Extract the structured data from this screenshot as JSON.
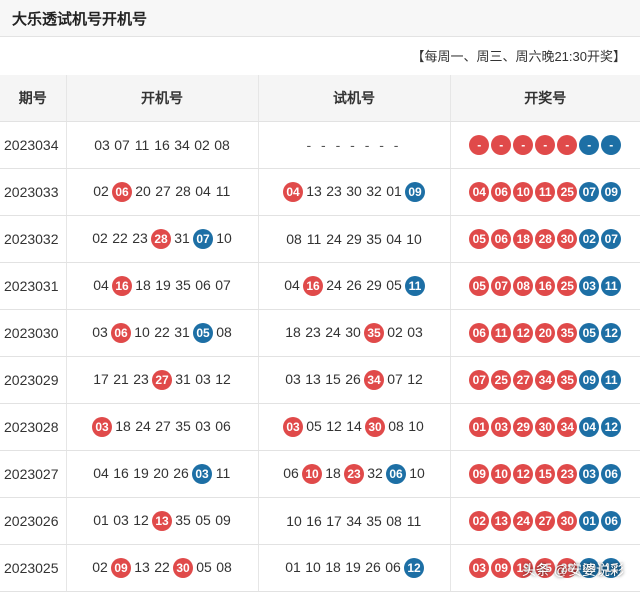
{
  "title": "大乐透试机号开机号",
  "schedule": "【每周一、周三、周六晚21:30开奖】",
  "headers": [
    "期号",
    "开机号",
    "试机号",
    "开奖号"
  ],
  "colors": {
    "red": "#e04a4a",
    "blue": "#1d6fa5"
  },
  "watermark": "头条 @安婆说彩",
  "rows": [
    {
      "period": "2023034",
      "open": [
        {
          "v": "03",
          "c": "p"
        },
        {
          "v": "07",
          "c": "p"
        },
        {
          "v": "11",
          "c": "p"
        },
        {
          "v": "16",
          "c": "p"
        },
        {
          "v": "34",
          "c": "p"
        },
        {
          "v": "02",
          "c": "p"
        },
        {
          "v": "08",
          "c": "p"
        }
      ],
      "test": [
        {
          "v": "- - - - - - -",
          "c": "d"
        }
      ],
      "draw": [
        {
          "v": "-",
          "c": "r"
        },
        {
          "v": "-",
          "c": "r"
        },
        {
          "v": "-",
          "c": "r"
        },
        {
          "v": "-",
          "c": "r"
        },
        {
          "v": "-",
          "c": "r"
        },
        {
          "v": "-",
          "c": "b"
        },
        {
          "v": "-",
          "c": "b"
        }
      ]
    },
    {
      "period": "2023033",
      "open": [
        {
          "v": "02",
          "c": "p"
        },
        {
          "v": "06",
          "c": "r"
        },
        {
          "v": "20",
          "c": "p"
        },
        {
          "v": "27",
          "c": "p"
        },
        {
          "v": "28",
          "c": "p"
        },
        {
          "v": "04",
          "c": "p"
        },
        {
          "v": "11",
          "c": "p"
        }
      ],
      "test": [
        {
          "v": "04",
          "c": "r"
        },
        {
          "v": "13",
          "c": "p"
        },
        {
          "v": "23",
          "c": "p"
        },
        {
          "v": "30",
          "c": "p"
        },
        {
          "v": "32",
          "c": "p"
        },
        {
          "v": "01",
          "c": "p"
        },
        {
          "v": "09",
          "c": "b"
        }
      ],
      "draw": [
        {
          "v": "04",
          "c": "r"
        },
        {
          "v": "06",
          "c": "r"
        },
        {
          "v": "10",
          "c": "r"
        },
        {
          "v": "11",
          "c": "r"
        },
        {
          "v": "25",
          "c": "r"
        },
        {
          "v": "07",
          "c": "b"
        },
        {
          "v": "09",
          "c": "b"
        }
      ]
    },
    {
      "period": "2023032",
      "open": [
        {
          "v": "02",
          "c": "p"
        },
        {
          "v": "22",
          "c": "p"
        },
        {
          "v": "23",
          "c": "p"
        },
        {
          "v": "28",
          "c": "r"
        },
        {
          "v": "31",
          "c": "p"
        },
        {
          "v": "07",
          "c": "b"
        },
        {
          "v": "10",
          "c": "p"
        }
      ],
      "test": [
        {
          "v": "08",
          "c": "p"
        },
        {
          "v": "11",
          "c": "p"
        },
        {
          "v": "24",
          "c": "p"
        },
        {
          "v": "29",
          "c": "p"
        },
        {
          "v": "35",
          "c": "p"
        },
        {
          "v": "04",
          "c": "p"
        },
        {
          "v": "10",
          "c": "p"
        }
      ],
      "draw": [
        {
          "v": "05",
          "c": "r"
        },
        {
          "v": "06",
          "c": "r"
        },
        {
          "v": "18",
          "c": "r"
        },
        {
          "v": "28",
          "c": "r"
        },
        {
          "v": "30",
          "c": "r"
        },
        {
          "v": "02",
          "c": "b"
        },
        {
          "v": "07",
          "c": "b"
        }
      ]
    },
    {
      "period": "2023031",
      "open": [
        {
          "v": "04",
          "c": "p"
        },
        {
          "v": "16",
          "c": "r"
        },
        {
          "v": "18",
          "c": "p"
        },
        {
          "v": "19",
          "c": "p"
        },
        {
          "v": "35",
          "c": "p"
        },
        {
          "v": "06",
          "c": "p"
        },
        {
          "v": "07",
          "c": "p"
        }
      ],
      "test": [
        {
          "v": "04",
          "c": "p"
        },
        {
          "v": "16",
          "c": "r"
        },
        {
          "v": "24",
          "c": "p"
        },
        {
          "v": "26",
          "c": "p"
        },
        {
          "v": "29",
          "c": "p"
        },
        {
          "v": "05",
          "c": "p"
        },
        {
          "v": "11",
          "c": "b"
        }
      ],
      "draw": [
        {
          "v": "05",
          "c": "r"
        },
        {
          "v": "07",
          "c": "r"
        },
        {
          "v": "08",
          "c": "r"
        },
        {
          "v": "16",
          "c": "r"
        },
        {
          "v": "25",
          "c": "r"
        },
        {
          "v": "03",
          "c": "b"
        },
        {
          "v": "11",
          "c": "b"
        }
      ]
    },
    {
      "period": "2023030",
      "open": [
        {
          "v": "03",
          "c": "p"
        },
        {
          "v": "06",
          "c": "r"
        },
        {
          "v": "10",
          "c": "p"
        },
        {
          "v": "22",
          "c": "p"
        },
        {
          "v": "31",
          "c": "p"
        },
        {
          "v": "05",
          "c": "b"
        },
        {
          "v": "08",
          "c": "p"
        }
      ],
      "test": [
        {
          "v": "18",
          "c": "p"
        },
        {
          "v": "23",
          "c": "p"
        },
        {
          "v": "24",
          "c": "p"
        },
        {
          "v": "30",
          "c": "p"
        },
        {
          "v": "35",
          "c": "r"
        },
        {
          "v": "02",
          "c": "p"
        },
        {
          "v": "03",
          "c": "p"
        }
      ],
      "draw": [
        {
          "v": "06",
          "c": "r"
        },
        {
          "v": "11",
          "c": "r"
        },
        {
          "v": "12",
          "c": "r"
        },
        {
          "v": "20",
          "c": "r"
        },
        {
          "v": "35",
          "c": "r"
        },
        {
          "v": "05",
          "c": "b"
        },
        {
          "v": "12",
          "c": "b"
        }
      ]
    },
    {
      "period": "2023029",
      "open": [
        {
          "v": "17",
          "c": "p"
        },
        {
          "v": "21",
          "c": "p"
        },
        {
          "v": "23",
          "c": "p"
        },
        {
          "v": "27",
          "c": "r"
        },
        {
          "v": "31",
          "c": "p"
        },
        {
          "v": "03",
          "c": "p"
        },
        {
          "v": "12",
          "c": "p"
        }
      ],
      "test": [
        {
          "v": "03",
          "c": "p"
        },
        {
          "v": "13",
          "c": "p"
        },
        {
          "v": "15",
          "c": "p"
        },
        {
          "v": "26",
          "c": "p"
        },
        {
          "v": "34",
          "c": "r"
        },
        {
          "v": "07",
          "c": "p"
        },
        {
          "v": "12",
          "c": "p"
        }
      ],
      "draw": [
        {
          "v": "07",
          "c": "r"
        },
        {
          "v": "25",
          "c": "r"
        },
        {
          "v": "27",
          "c": "r"
        },
        {
          "v": "34",
          "c": "r"
        },
        {
          "v": "35",
          "c": "r"
        },
        {
          "v": "09",
          "c": "b"
        },
        {
          "v": "11",
          "c": "b"
        }
      ]
    },
    {
      "period": "2023028",
      "open": [
        {
          "v": "03",
          "c": "r"
        },
        {
          "v": "18",
          "c": "p"
        },
        {
          "v": "24",
          "c": "p"
        },
        {
          "v": "27",
          "c": "p"
        },
        {
          "v": "35",
          "c": "p"
        },
        {
          "v": "03",
          "c": "p"
        },
        {
          "v": "06",
          "c": "p"
        }
      ],
      "test": [
        {
          "v": "03",
          "c": "r"
        },
        {
          "v": "05",
          "c": "p"
        },
        {
          "v": "12",
          "c": "p"
        },
        {
          "v": "14",
          "c": "p"
        },
        {
          "v": "30",
          "c": "r"
        },
        {
          "v": "08",
          "c": "p"
        },
        {
          "v": "10",
          "c": "p"
        }
      ],
      "draw": [
        {
          "v": "01",
          "c": "r"
        },
        {
          "v": "03",
          "c": "r"
        },
        {
          "v": "29",
          "c": "r"
        },
        {
          "v": "30",
          "c": "r"
        },
        {
          "v": "34",
          "c": "r"
        },
        {
          "v": "04",
          "c": "b"
        },
        {
          "v": "12",
          "c": "b"
        }
      ]
    },
    {
      "period": "2023027",
      "open": [
        {
          "v": "04",
          "c": "p"
        },
        {
          "v": "16",
          "c": "p"
        },
        {
          "v": "19",
          "c": "p"
        },
        {
          "v": "20",
          "c": "p"
        },
        {
          "v": "26",
          "c": "p"
        },
        {
          "v": "03",
          "c": "b"
        },
        {
          "v": "11",
          "c": "p"
        }
      ],
      "test": [
        {
          "v": "06",
          "c": "p"
        },
        {
          "v": "10",
          "c": "r"
        },
        {
          "v": "18",
          "c": "p"
        },
        {
          "v": "23",
          "c": "r"
        },
        {
          "v": "32",
          "c": "p"
        },
        {
          "v": "06",
          "c": "b"
        },
        {
          "v": "10",
          "c": "p"
        }
      ],
      "draw": [
        {
          "v": "09",
          "c": "r"
        },
        {
          "v": "10",
          "c": "r"
        },
        {
          "v": "12",
          "c": "r"
        },
        {
          "v": "15",
          "c": "r"
        },
        {
          "v": "23",
          "c": "r"
        },
        {
          "v": "03",
          "c": "b"
        },
        {
          "v": "06",
          "c": "b"
        }
      ]
    },
    {
      "period": "2023026",
      "open": [
        {
          "v": "01",
          "c": "p"
        },
        {
          "v": "03",
          "c": "p"
        },
        {
          "v": "12",
          "c": "p"
        },
        {
          "v": "13",
          "c": "r"
        },
        {
          "v": "35",
          "c": "p"
        },
        {
          "v": "05",
          "c": "p"
        },
        {
          "v": "09",
          "c": "p"
        }
      ],
      "test": [
        {
          "v": "10",
          "c": "p"
        },
        {
          "v": "16",
          "c": "p"
        },
        {
          "v": "17",
          "c": "p"
        },
        {
          "v": "34",
          "c": "p"
        },
        {
          "v": "35",
          "c": "p"
        },
        {
          "v": "08",
          "c": "p"
        },
        {
          "v": "11",
          "c": "p"
        }
      ],
      "draw": [
        {
          "v": "02",
          "c": "r"
        },
        {
          "v": "13",
          "c": "r"
        },
        {
          "v": "24",
          "c": "r"
        },
        {
          "v": "27",
          "c": "r"
        },
        {
          "v": "30",
          "c": "r"
        },
        {
          "v": "01",
          "c": "b"
        },
        {
          "v": "06",
          "c": "b"
        }
      ]
    },
    {
      "period": "2023025",
      "open": [
        {
          "v": "02",
          "c": "p"
        },
        {
          "v": "09",
          "c": "r"
        },
        {
          "v": "13",
          "c": "p"
        },
        {
          "v": "22",
          "c": "p"
        },
        {
          "v": "30",
          "c": "r"
        },
        {
          "v": "05",
          "c": "p"
        },
        {
          "v": "08",
          "c": "p"
        }
      ],
      "test": [
        {
          "v": "01",
          "c": "p"
        },
        {
          "v": "10",
          "c": "p"
        },
        {
          "v": "18",
          "c": "p"
        },
        {
          "v": "19",
          "c": "p"
        },
        {
          "v": "26",
          "c": "p"
        },
        {
          "v": "06",
          "c": "p"
        },
        {
          "v": "12",
          "c": "b"
        }
      ],
      "draw": [
        {
          "v": "03",
          "c": "r"
        },
        {
          "v": "09",
          "c": "r"
        },
        {
          "v": "19",
          "c": "r"
        },
        {
          "v": "25",
          "c": "r"
        },
        {
          "v": "28",
          "c": "r"
        },
        {
          "v": "09",
          "c": "b"
        },
        {
          "v": "12",
          "c": "b"
        }
      ]
    }
  ]
}
